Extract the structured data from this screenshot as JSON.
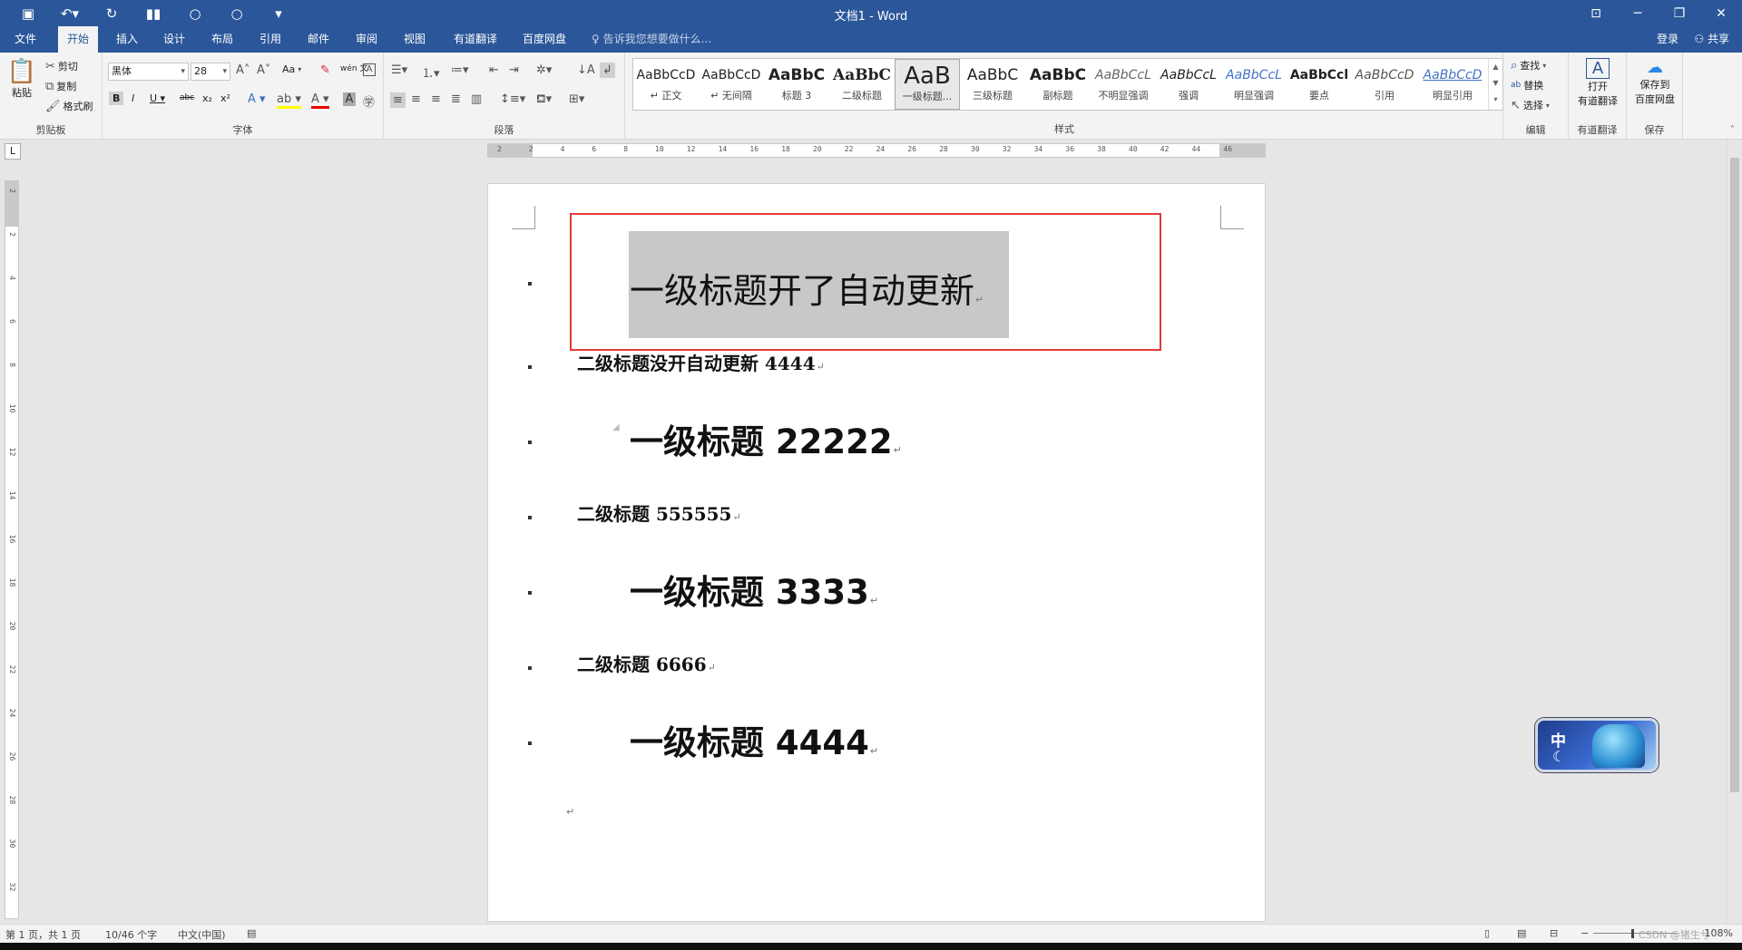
{
  "window": {
    "title": "文档1 - Word"
  },
  "tabs": [
    "文件",
    "开始",
    "插入",
    "设计",
    "布局",
    "引用",
    "邮件",
    "审阅",
    "视图",
    "有道翻译",
    "百度网盘"
  ],
  "active_tab": "开始",
  "tell_me": "告诉我您想要做什么...",
  "account": {
    "login": "登录",
    "share": "共享"
  },
  "clipboard": {
    "paste": "粘贴",
    "cut": "剪切",
    "copy": "复制",
    "format_painter": "格式刷",
    "label": "剪贴板"
  },
  "font": {
    "name": "黑体",
    "size": "28",
    "case": "Aa",
    "label": "字体",
    "wen": "wén 文"
  },
  "paragraph": {
    "label": "段落"
  },
  "styles": {
    "label": "样式",
    "items": [
      {
        "preview": "AaBbCcD",
        "name": "↵ 正文"
      },
      {
        "preview": "AaBbCcD",
        "name": "↵ 无间隔"
      },
      {
        "preview": "AaBbC",
        "name": "标题 3"
      },
      {
        "preview": "AaBbC",
        "name": "二级标题"
      },
      {
        "preview": "AaB",
        "name": "一级标题..."
      },
      {
        "preview": "AaBbC",
        "name": "三级标题"
      },
      {
        "preview": "AaBbC",
        "name": "副标题"
      },
      {
        "preview": "AaBbCcL",
        "name": "不明显强调"
      },
      {
        "preview": "AaBbCcL",
        "name": "强调"
      },
      {
        "preview": "AaBbCcL",
        "name": "明显强调"
      },
      {
        "preview": "AaBbCcl",
        "name": "要点"
      },
      {
        "preview": "AaBbCcD",
        "name": "引用"
      },
      {
        "preview": "AaBbCcD",
        "name": "明显引用"
      }
    ]
  },
  "editing": {
    "find": "查找",
    "replace": "替换",
    "select": "选择",
    "label": "编辑"
  },
  "youdao": {
    "open": "打开",
    "open2": "有道翻译",
    "label": "有道翻译"
  },
  "baidu": {
    "save": "保存到",
    "save2": "百度网盘",
    "label": "保存"
  },
  "ruler_h": [
    "2",
    "2",
    "4",
    "6",
    "8",
    "10",
    "12",
    "14",
    "16",
    "18",
    "20",
    "22",
    "24",
    "26",
    "28",
    "30",
    "32",
    "34",
    "36",
    "38",
    "40",
    "42",
    "44",
    "46"
  ],
  "ruler_v": [
    "2",
    "2",
    "4",
    "6",
    "8",
    "10",
    "12",
    "14",
    "16",
    "18",
    "20",
    "22",
    "24",
    "26",
    "28",
    "30",
    "32"
  ],
  "document": {
    "paragraphs": [
      {
        "text": "一级标题开了自动更新",
        "level": 1
      },
      {
        "text": "二级标题没开自动更新 4444",
        "level": 2
      },
      {
        "text": "一级标题 22222",
        "level": 1
      },
      {
        "text": "二级标题 555555",
        "level": 2
      },
      {
        "text": "一级标题 3333",
        "level": 1
      },
      {
        "text": "二级标题 6666",
        "level": 2
      },
      {
        "text": "一级标题 4444",
        "level": 1
      }
    ],
    "para_mark": "↵"
  },
  "status": {
    "page": "第 1 页，共 1 页",
    "words": "10/46 个字",
    "lang": "中文(中国)",
    "watermark": "CSDN @猪生兮",
    "zoom": "108%"
  },
  "ime": {
    "label": "中"
  },
  "colors": {
    "titlebar": "#2b579a",
    "selection_box": "#e23b3b",
    "selection": "#c8c8c8"
  }
}
